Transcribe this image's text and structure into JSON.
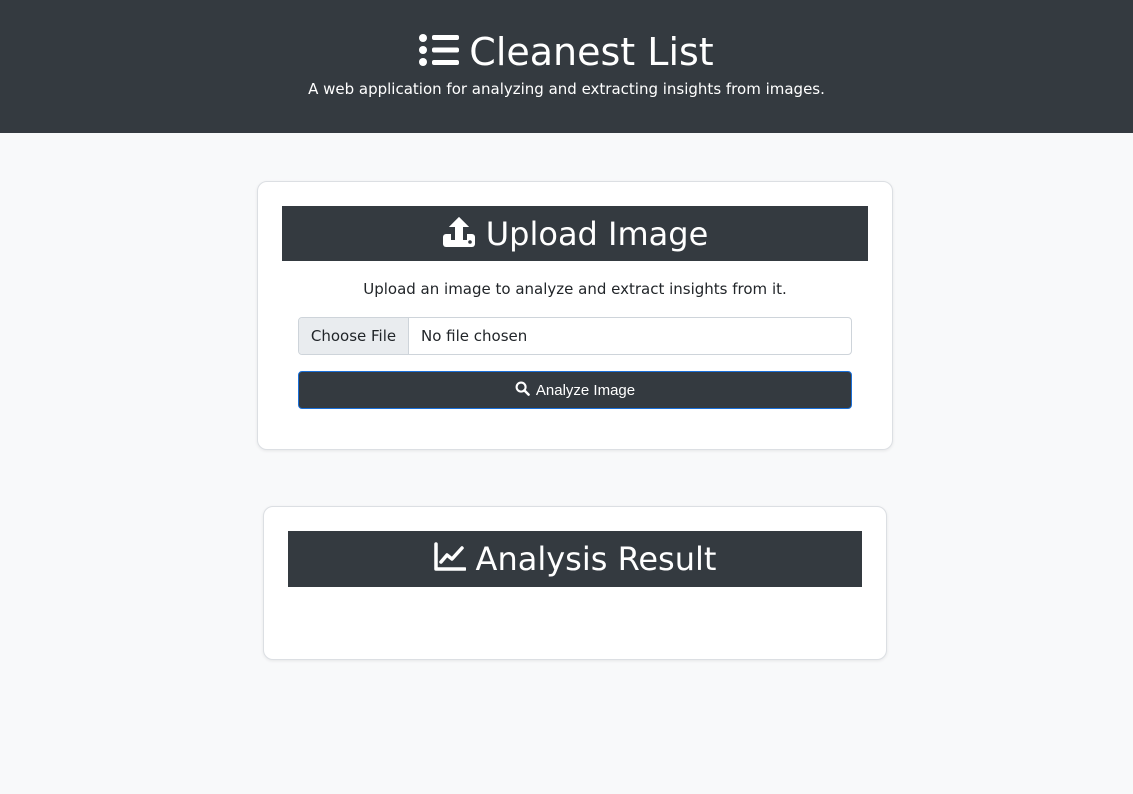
{
  "header": {
    "title": "Cleanest List",
    "tagline": "A web application for analyzing and extracting insights from images.",
    "icon": "list-icon"
  },
  "upload": {
    "heading": "Upload Image",
    "icon": "upload-icon",
    "description": "Upload an image to analyze and extract insights from it.",
    "choose_file_label": "Choose File",
    "file_status": "No file chosen",
    "analyze_label": "Analyze Image",
    "analyze_icon": "search-icon"
  },
  "result": {
    "heading": "Analysis Result",
    "icon": "chart-line-icon"
  },
  "colors": {
    "header_bg": "#343a40",
    "page_bg": "#f8f9fa",
    "button_border": "#1a6fd8"
  }
}
